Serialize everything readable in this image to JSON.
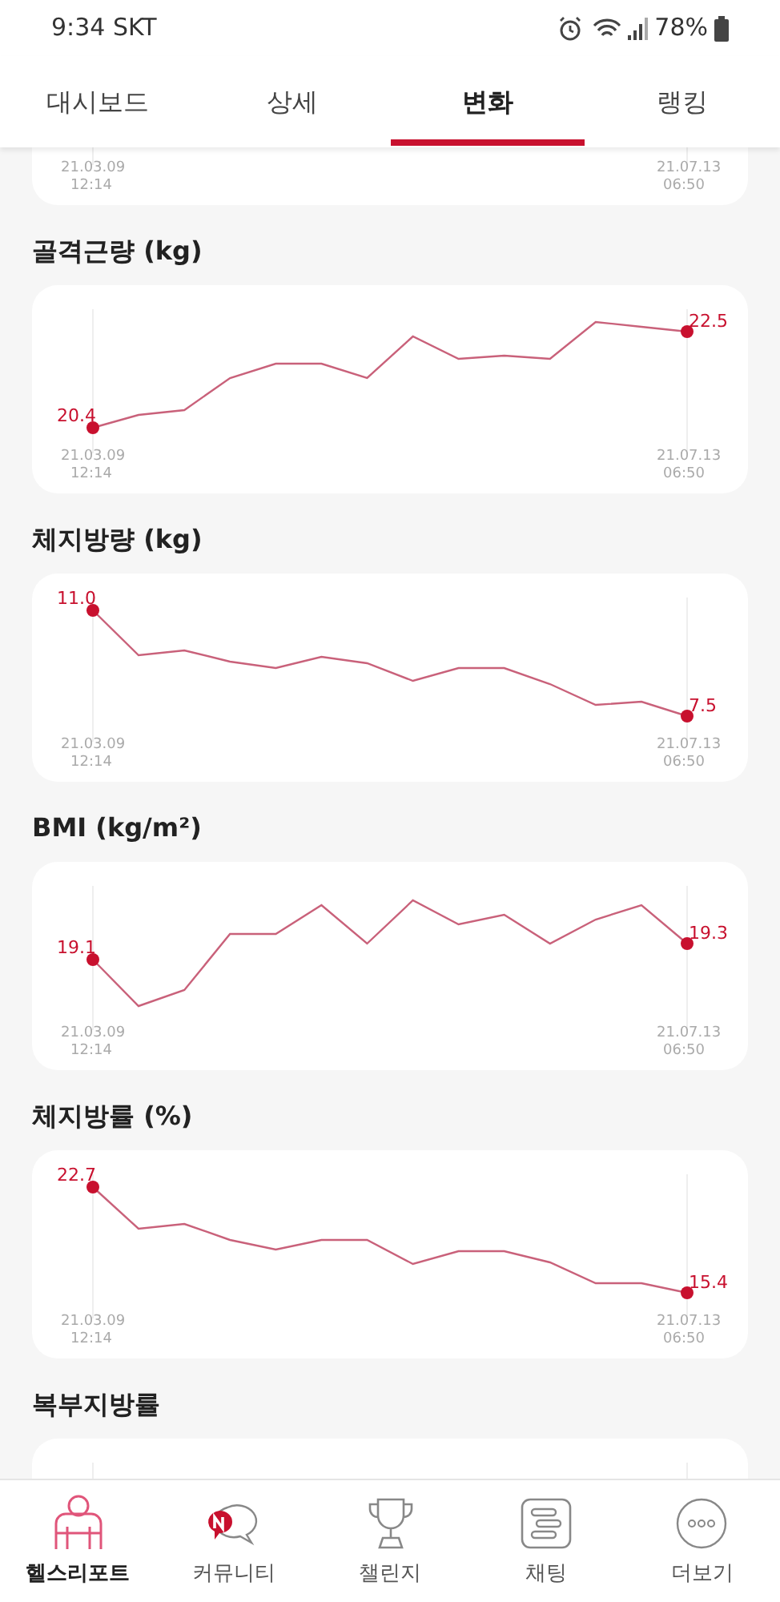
{
  "status_bar": {
    "time": "9:34 SKT",
    "battery": "78%"
  },
  "tabs": [
    {
      "label": "대시보드",
      "selected": false
    },
    {
      "label": "상세",
      "selected": false
    },
    {
      "label": "변화",
      "selected": true
    },
    {
      "label": "랭킹",
      "selected": false
    }
  ],
  "top_card": {
    "start_date": "21.03.09",
    "start_time": "12:14",
    "end_date": "21.07.13",
    "end_time": "06:50"
  },
  "sections": [
    {
      "title": "골격근량 (kg)",
      "start_value": "20.4",
      "end_value": "22.5",
      "start_date": "21.03.09",
      "start_time": "12:14",
      "end_date": "21.07.13",
      "end_time": "06:50"
    },
    {
      "title": "체지방량 (kg)",
      "start_value": "11.0",
      "end_value": "7.5",
      "start_date": "21.03.09",
      "start_time": "12:14",
      "end_date": "21.07.13",
      "end_time": "06:50"
    },
    {
      "title": "BMI (kg/m²)",
      "start_value": "19.1",
      "end_value": "19.3",
      "start_date": "21.03.09",
      "start_time": "12:14",
      "end_date": "21.07.13",
      "end_time": "06:50"
    },
    {
      "title": "체지방률 (%)",
      "start_value": "22.7",
      "end_value": "15.4",
      "start_date": "21.03.09",
      "start_time": "12:14",
      "end_date": "21.07.13",
      "end_time": "06:50"
    }
  ],
  "bottom_section": {
    "title": "복부지방률"
  },
  "bottom_nav": [
    {
      "label": "헬스리포트",
      "selected": true
    },
    {
      "label": "커뮤니티",
      "selected": false
    },
    {
      "label": "챌린지",
      "selected": false
    },
    {
      "label": "채팅",
      "selected": false
    },
    {
      "label": "더보기",
      "selected": false
    }
  ]
}
